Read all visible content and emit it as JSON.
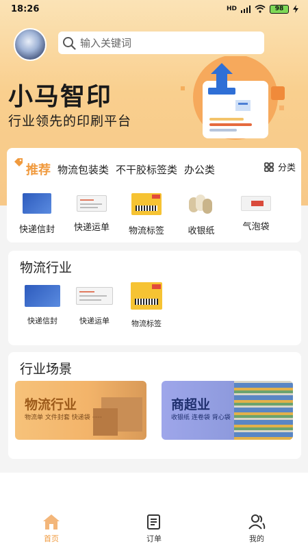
{
  "status_bar": {
    "time": "18:26",
    "signal_label": "HD",
    "battery": "98"
  },
  "header": {
    "search_placeholder": "输入关键词",
    "brand_title": "小马智印",
    "brand_subtitle": "行业领先的印刷平台"
  },
  "recommend": {
    "tabs": [
      {
        "label": "推荐",
        "active": true
      },
      {
        "label": "物流包装类"
      },
      {
        "label": "不干胶标签类"
      },
      {
        "label": "办公类"
      }
    ],
    "more_label": "分类",
    "items": [
      {
        "label": "快递信封",
        "icon": "express-envelope-icon"
      },
      {
        "label": "快递运单",
        "icon": "waybill-icon"
      },
      {
        "label": "物流标签",
        "icon": "logistics-label-icon"
      },
      {
        "label": "收银纸",
        "icon": "cash-register-paper-icon"
      },
      {
        "label": "气泡袋",
        "icon": "bubble-bag-icon"
      }
    ]
  },
  "logistics": {
    "title": "物流行业",
    "items": [
      {
        "label": "快递信封",
        "icon": "express-envelope-icon"
      },
      {
        "label": "快递运单",
        "icon": "waybill-icon"
      },
      {
        "label": "物流标签",
        "icon": "logistics-label-icon"
      }
    ]
  },
  "scenes": {
    "title": "行业场景",
    "banners": [
      {
        "title": "物流行业",
        "subtitle": "物流单  文件封套  快递袋 ·····"
      },
      {
        "title": "商超业",
        "subtitle": "收银纸  连卷袋  背心袋"
      }
    ]
  },
  "bottom_nav": [
    {
      "label": "首页",
      "icon": "home-icon",
      "active": true
    },
    {
      "label": "订单",
      "icon": "orders-icon"
    },
    {
      "label": "我的",
      "icon": "profile-icon"
    }
  ],
  "colors": {
    "accent": "#f09a3e",
    "hero_top": "#fbe3b6",
    "hero_bottom": "#f7c888"
  }
}
